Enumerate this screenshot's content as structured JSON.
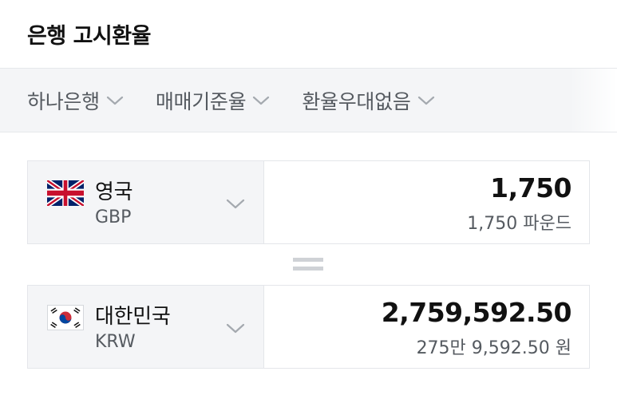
{
  "header": {
    "title": "은행 고시환율"
  },
  "filters": [
    {
      "label": "하나은행"
    },
    {
      "label": "매매기준율"
    },
    {
      "label": "환율우대없음"
    }
  ],
  "from": {
    "country": "영국",
    "code": "GBP",
    "flag_icon": "uk-flag-icon",
    "amount": "1,750",
    "amount_text": "1,750 파운드"
  },
  "to": {
    "country": "대한민국",
    "code": "KRW",
    "flag_icon": "korea-flag-icon",
    "amount": "2,759,592.50",
    "amount_text": "275만 9,592.50 원"
  },
  "colors": {
    "panel_bg": "#f4f5f7",
    "border": "#e4e6ea",
    "text_primary": "#111111",
    "text_secondary": "#555a60",
    "chevron": "#9aa0a6"
  }
}
